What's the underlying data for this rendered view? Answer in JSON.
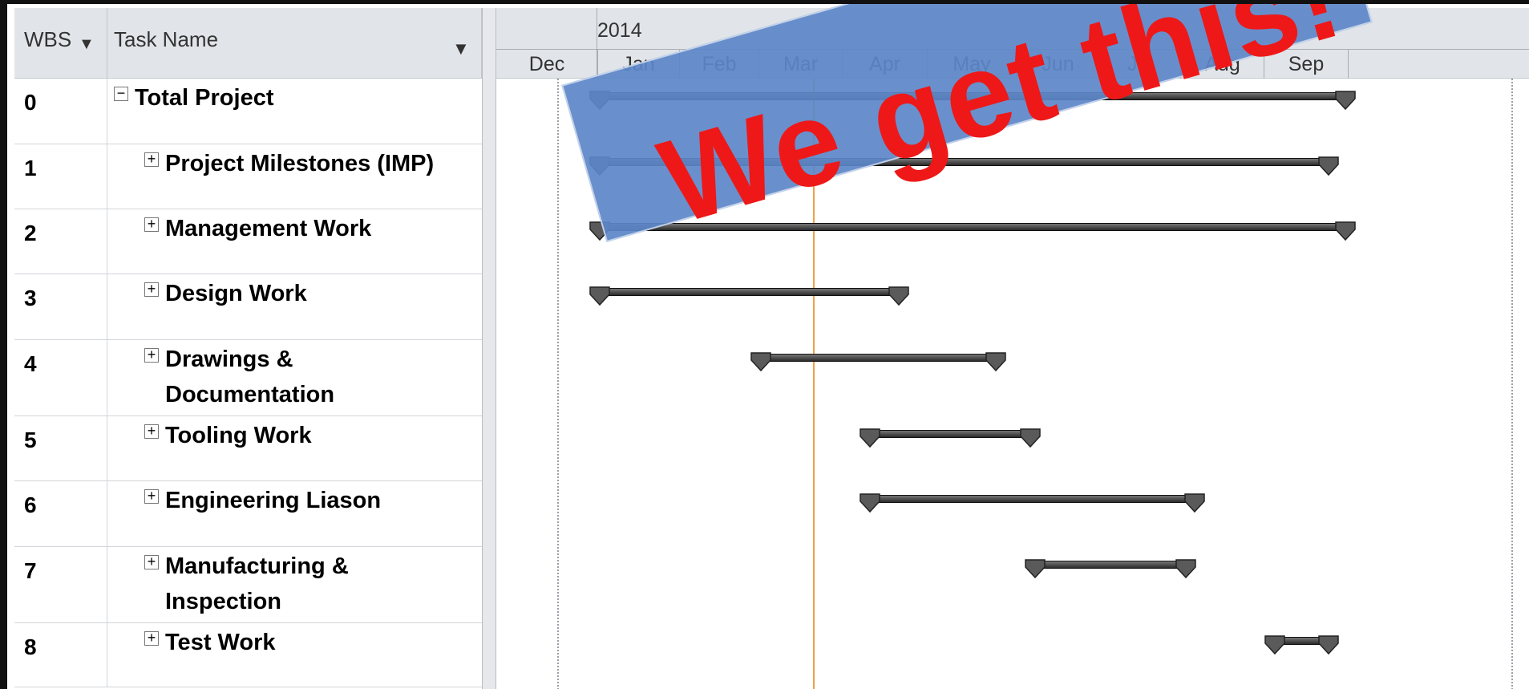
{
  "table": {
    "col_wbs": "WBS",
    "col_task": "Task Name",
    "rows": [
      {
        "wbs": "0",
        "name": "Total Project",
        "toggle": "−"
      },
      {
        "wbs": "1",
        "name": "Project Milestones (IMP)",
        "toggle": "+"
      },
      {
        "wbs": "2",
        "name": "Management Work",
        "toggle": "+"
      },
      {
        "wbs": "3",
        "name": "Design Work",
        "toggle": "+"
      },
      {
        "wbs": "4",
        "name_line1": "Drawings &",
        "name_line2": "Documentation",
        "toggle": "+"
      },
      {
        "wbs": "5",
        "name": "Tooling Work",
        "toggle": "+"
      },
      {
        "wbs": "6",
        "name": "Engineering Liason",
        "toggle": "+"
      },
      {
        "wbs": "7",
        "name_line1": "Manufacturing &",
        "name_line2": "Inspection",
        "toggle": "+"
      },
      {
        "wbs": "8",
        "name": "Test Work",
        "toggle": "+"
      }
    ]
  },
  "timescale": {
    "year": "2014",
    "months": [
      "Dec",
      "Jan",
      "Feb",
      "Mar",
      "Apr",
      "May",
      "Jun",
      "Jul",
      "Aug",
      "Sep"
    ]
  },
  "schedule": [
    {
      "start_month": 1.0,
      "end_month": 10.0
    },
    {
      "start_month": 1.0,
      "end_month": 9.8
    },
    {
      "start_month": 1.0,
      "end_month": 10.0
    },
    {
      "start_month": 1.0,
      "end_month": 4.7
    },
    {
      "start_month": 3.0,
      "end_month": 5.8
    },
    {
      "start_month": 4.3,
      "end_month": 6.2
    },
    {
      "start_month": 4.3,
      "end_month": 8.2
    },
    {
      "start_month": 6.2,
      "end_month": 8.1
    },
    {
      "start_month": 9.1,
      "end_month": 9.8
    }
  ],
  "status_month": 3.65,
  "banner": {
    "text": "We get this!"
  },
  "colors": {
    "status_line": "#f0a048",
    "banner_bg": "#5c87c8",
    "banner_text": "#ee1818"
  }
}
